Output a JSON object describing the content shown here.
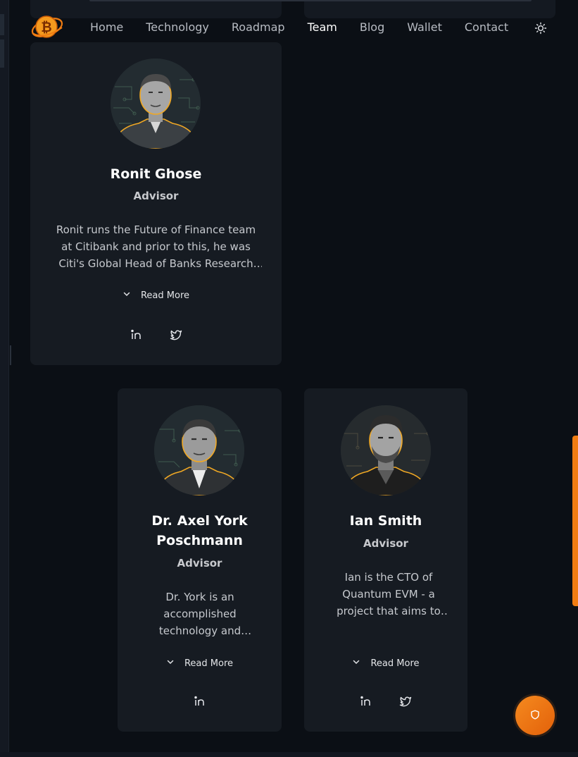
{
  "nav": {
    "items": [
      {
        "label": "Home"
      },
      {
        "label": "Technology"
      },
      {
        "label": "Roadmap"
      },
      {
        "label": "Team",
        "active": true
      },
      {
        "label": "Blog"
      },
      {
        "label": "Wallet"
      },
      {
        "label": "Contact"
      }
    ],
    "theme_icon": "sun-icon",
    "logo_icon": "bitcoin-logo-icon"
  },
  "team": [
    {
      "name": "Ronit Ghose",
      "role": "Advisor",
      "bio": "Ronit runs the Future of Finance team at Citibank and prior to this, he was Citi's Global Head of Banks Research and...",
      "read_more": "Read More"
    },
    {
      "name": "Dr. Axel York Poschmann",
      "role": "Advisor",
      "bio": "Dr. York is an accomplished technology and business leader...",
      "read_more": "Read More"
    },
    {
      "name": "Ian Smith",
      "role": "Advisor",
      "bio": "Ian is the CTO of Quantum EVM - a project that aims to bring...",
      "read_more": "Read More"
    }
  ],
  "icons": {
    "linkedin": "linkedin-icon",
    "twitter": "twitter-icon",
    "chevron": "chevron-down-icon",
    "shield": "shield-icon"
  },
  "colors": {
    "accent": "#f07c12",
    "background": "#0b0f15",
    "card": "#161b22",
    "portrait_line": "#f0a824"
  }
}
